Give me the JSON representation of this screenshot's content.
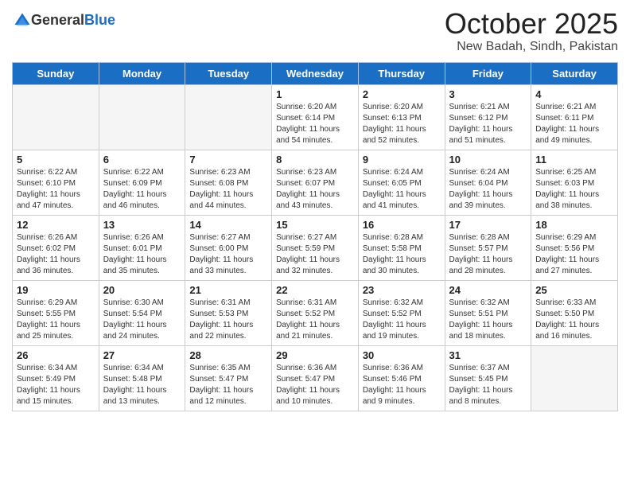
{
  "header": {
    "logo_general": "General",
    "logo_blue": "Blue",
    "month": "October 2025",
    "location": "New Badah, Sindh, Pakistan"
  },
  "days_of_week": [
    "Sunday",
    "Monday",
    "Tuesday",
    "Wednesday",
    "Thursday",
    "Friday",
    "Saturday"
  ],
  "weeks": [
    [
      {
        "day": null
      },
      {
        "day": null
      },
      {
        "day": null
      },
      {
        "day": "1",
        "sunrise": "Sunrise: 6:20 AM",
        "sunset": "Sunset: 6:14 PM",
        "daylight": "Daylight: 11 hours and 54 minutes."
      },
      {
        "day": "2",
        "sunrise": "Sunrise: 6:20 AM",
        "sunset": "Sunset: 6:13 PM",
        "daylight": "Daylight: 11 hours and 52 minutes."
      },
      {
        "day": "3",
        "sunrise": "Sunrise: 6:21 AM",
        "sunset": "Sunset: 6:12 PM",
        "daylight": "Daylight: 11 hours and 51 minutes."
      },
      {
        "day": "4",
        "sunrise": "Sunrise: 6:21 AM",
        "sunset": "Sunset: 6:11 PM",
        "daylight": "Daylight: 11 hours and 49 minutes."
      }
    ],
    [
      {
        "day": "5",
        "sunrise": "Sunrise: 6:22 AM",
        "sunset": "Sunset: 6:10 PM",
        "daylight": "Daylight: 11 hours and 47 minutes."
      },
      {
        "day": "6",
        "sunrise": "Sunrise: 6:22 AM",
        "sunset": "Sunset: 6:09 PM",
        "daylight": "Daylight: 11 hours and 46 minutes."
      },
      {
        "day": "7",
        "sunrise": "Sunrise: 6:23 AM",
        "sunset": "Sunset: 6:08 PM",
        "daylight": "Daylight: 11 hours and 44 minutes."
      },
      {
        "day": "8",
        "sunrise": "Sunrise: 6:23 AM",
        "sunset": "Sunset: 6:07 PM",
        "daylight": "Daylight: 11 hours and 43 minutes."
      },
      {
        "day": "9",
        "sunrise": "Sunrise: 6:24 AM",
        "sunset": "Sunset: 6:05 PM",
        "daylight": "Daylight: 11 hours and 41 minutes."
      },
      {
        "day": "10",
        "sunrise": "Sunrise: 6:24 AM",
        "sunset": "Sunset: 6:04 PM",
        "daylight": "Daylight: 11 hours and 39 minutes."
      },
      {
        "day": "11",
        "sunrise": "Sunrise: 6:25 AM",
        "sunset": "Sunset: 6:03 PM",
        "daylight": "Daylight: 11 hours and 38 minutes."
      }
    ],
    [
      {
        "day": "12",
        "sunrise": "Sunrise: 6:26 AM",
        "sunset": "Sunset: 6:02 PM",
        "daylight": "Daylight: 11 hours and 36 minutes."
      },
      {
        "day": "13",
        "sunrise": "Sunrise: 6:26 AM",
        "sunset": "Sunset: 6:01 PM",
        "daylight": "Daylight: 11 hours and 35 minutes."
      },
      {
        "day": "14",
        "sunrise": "Sunrise: 6:27 AM",
        "sunset": "Sunset: 6:00 PM",
        "daylight": "Daylight: 11 hours and 33 minutes."
      },
      {
        "day": "15",
        "sunrise": "Sunrise: 6:27 AM",
        "sunset": "Sunset: 5:59 PM",
        "daylight": "Daylight: 11 hours and 32 minutes."
      },
      {
        "day": "16",
        "sunrise": "Sunrise: 6:28 AM",
        "sunset": "Sunset: 5:58 PM",
        "daylight": "Daylight: 11 hours and 30 minutes."
      },
      {
        "day": "17",
        "sunrise": "Sunrise: 6:28 AM",
        "sunset": "Sunset: 5:57 PM",
        "daylight": "Daylight: 11 hours and 28 minutes."
      },
      {
        "day": "18",
        "sunrise": "Sunrise: 6:29 AM",
        "sunset": "Sunset: 5:56 PM",
        "daylight": "Daylight: 11 hours and 27 minutes."
      }
    ],
    [
      {
        "day": "19",
        "sunrise": "Sunrise: 6:29 AM",
        "sunset": "Sunset: 5:55 PM",
        "daylight": "Daylight: 11 hours and 25 minutes."
      },
      {
        "day": "20",
        "sunrise": "Sunrise: 6:30 AM",
        "sunset": "Sunset: 5:54 PM",
        "daylight": "Daylight: 11 hours and 24 minutes."
      },
      {
        "day": "21",
        "sunrise": "Sunrise: 6:31 AM",
        "sunset": "Sunset: 5:53 PM",
        "daylight": "Daylight: 11 hours and 22 minutes."
      },
      {
        "day": "22",
        "sunrise": "Sunrise: 6:31 AM",
        "sunset": "Sunset: 5:52 PM",
        "daylight": "Daylight: 11 hours and 21 minutes."
      },
      {
        "day": "23",
        "sunrise": "Sunrise: 6:32 AM",
        "sunset": "Sunset: 5:52 PM",
        "daylight": "Daylight: 11 hours and 19 minutes."
      },
      {
        "day": "24",
        "sunrise": "Sunrise: 6:32 AM",
        "sunset": "Sunset: 5:51 PM",
        "daylight": "Daylight: 11 hours and 18 minutes."
      },
      {
        "day": "25",
        "sunrise": "Sunrise: 6:33 AM",
        "sunset": "Sunset: 5:50 PM",
        "daylight": "Daylight: 11 hours and 16 minutes."
      }
    ],
    [
      {
        "day": "26",
        "sunrise": "Sunrise: 6:34 AM",
        "sunset": "Sunset: 5:49 PM",
        "daylight": "Daylight: 11 hours and 15 minutes."
      },
      {
        "day": "27",
        "sunrise": "Sunrise: 6:34 AM",
        "sunset": "Sunset: 5:48 PM",
        "daylight": "Daylight: 11 hours and 13 minutes."
      },
      {
        "day": "28",
        "sunrise": "Sunrise: 6:35 AM",
        "sunset": "Sunset: 5:47 PM",
        "daylight": "Daylight: 11 hours and 12 minutes."
      },
      {
        "day": "29",
        "sunrise": "Sunrise: 6:36 AM",
        "sunset": "Sunset: 5:47 PM",
        "daylight": "Daylight: 11 hours and 10 minutes."
      },
      {
        "day": "30",
        "sunrise": "Sunrise: 6:36 AM",
        "sunset": "Sunset: 5:46 PM",
        "daylight": "Daylight: 11 hours and 9 minutes."
      },
      {
        "day": "31",
        "sunrise": "Sunrise: 6:37 AM",
        "sunset": "Sunset: 5:45 PM",
        "daylight": "Daylight: 11 hours and 8 minutes."
      },
      {
        "day": null
      }
    ]
  ]
}
